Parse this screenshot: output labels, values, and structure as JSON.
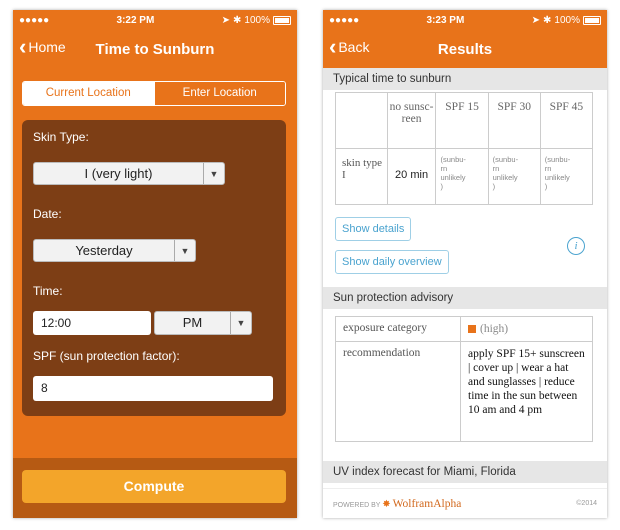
{
  "left": {
    "status": {
      "carrier": "●●●●●",
      "time": "3:22 PM",
      "battery": "100%"
    },
    "nav": {
      "back": "Home",
      "title": "Time to Sunburn"
    },
    "tabs": [
      {
        "label": "Current Location"
      },
      {
        "label": "Enter Location"
      }
    ],
    "form": {
      "skin_type_label": "Skin Type:",
      "skin_type_value": "I (very light)",
      "date_label": "Date:",
      "date_value": "Yesterday",
      "time_label": "Time:",
      "time_value": "12:00",
      "ampm_value": "PM",
      "spf_label": "SPF (sun protection factor):",
      "spf_value": "8"
    },
    "compute": "Compute"
  },
  "right": {
    "status": {
      "carrier": "●●●●●",
      "time": "3:23 PM",
      "battery": "100%"
    },
    "nav": {
      "back": "Back",
      "title": "Results"
    },
    "section1": "Typical time to sunburn",
    "table": {
      "headers": [
        "no sunsc-\nreen",
        "SPF 15",
        "SPF 30",
        "SPF 45"
      ],
      "row_label": "skin type I",
      "no_sunscreen": "20 min",
      "unlikely": "(sunbu-\nrn\nunlikely\n)"
    },
    "show_details": "Show details",
    "show_daily": "Show daily overview",
    "info": "i",
    "section2": "Sun protection advisory",
    "advisory": {
      "k1": "exposure category",
      "v1": "(high)",
      "k2": "recommendation",
      "v2": "apply SPF 15+ sunscreen  |  cover up  |  wear a hat and sunglasses  |  reduce time in the sun between 10 am and 4 pm"
    },
    "section3": "UV index forecast for Miami, Florida",
    "footer_powered": "POWERED BY",
    "footer_brand": "WolframAlpha",
    "footer_copy": "©2014"
  },
  "colors": {
    "accent": "#e8731a",
    "panel": "#7d3e15",
    "compute": "#f3a52a",
    "link": "#4aa3cf"
  }
}
